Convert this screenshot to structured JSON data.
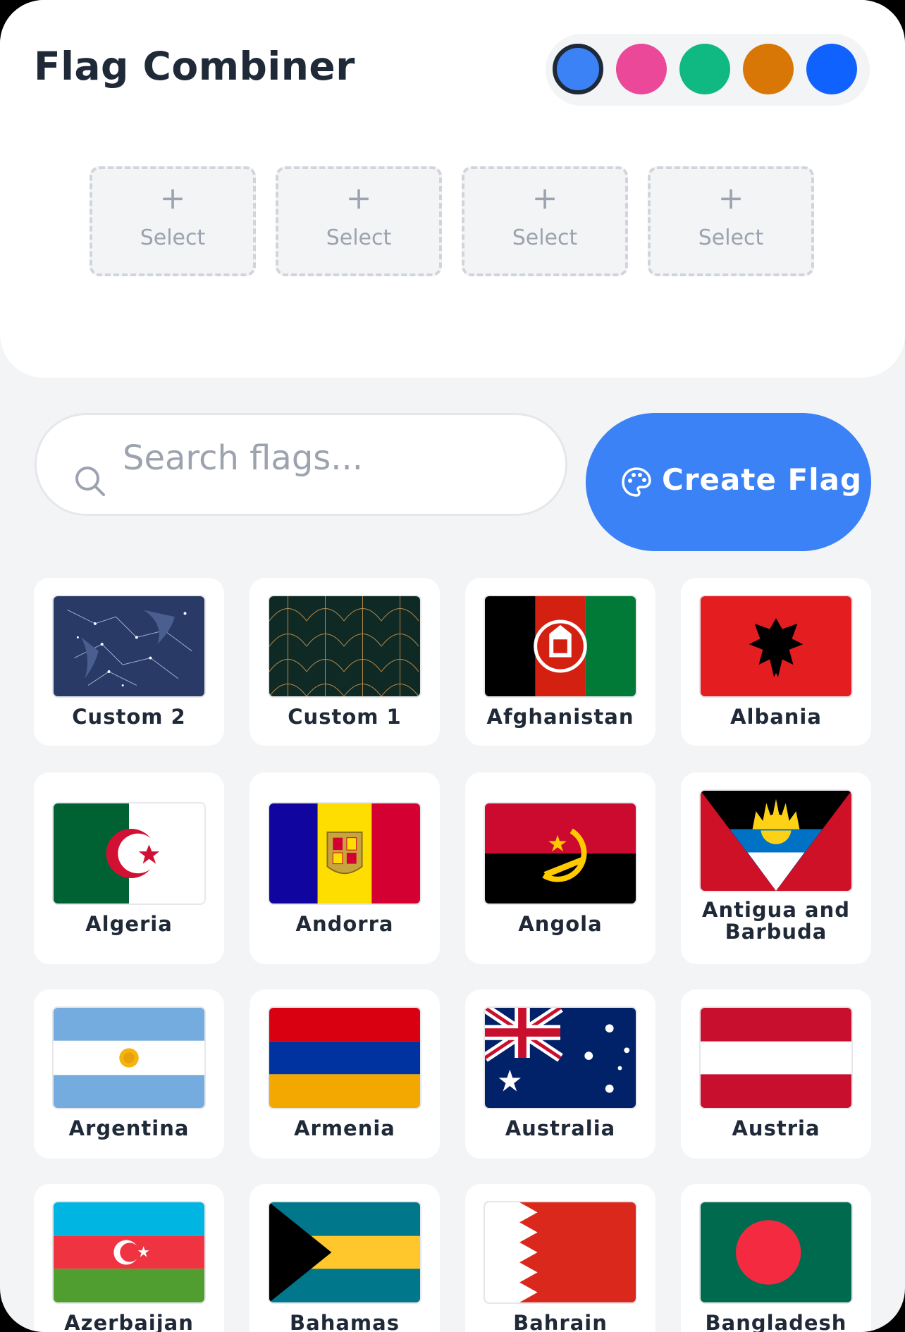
{
  "app": {
    "title": "Flag Combiner"
  },
  "colors": {
    "accent": "#3b82f6",
    "swatches": [
      "#3b82f6",
      "#ec4899",
      "#10b981",
      "#d97706",
      "#0f62fe"
    ]
  },
  "slots": [
    {
      "label": "Select"
    },
    {
      "label": "Select"
    },
    {
      "label": "Select"
    },
    {
      "label": "Select"
    }
  ],
  "search": {
    "placeholder": "Search flags..."
  },
  "create_button": {
    "label": "Create Flag"
  },
  "flags": [
    {
      "name": "Custom 2"
    },
    {
      "name": "Custom 1"
    },
    {
      "name": "Afghanistan"
    },
    {
      "name": "Albania"
    },
    {
      "name": "Algeria"
    },
    {
      "name": "Andorra"
    },
    {
      "name": "Angola"
    },
    {
      "name": "Antigua and Barbuda"
    },
    {
      "name": "Argentina"
    },
    {
      "name": "Armenia"
    },
    {
      "name": "Australia"
    },
    {
      "name": "Austria"
    },
    {
      "name": "Azerbaijan"
    },
    {
      "name": "Bahamas"
    },
    {
      "name": "Bahrain"
    },
    {
      "name": "Bangladesh"
    }
  ]
}
